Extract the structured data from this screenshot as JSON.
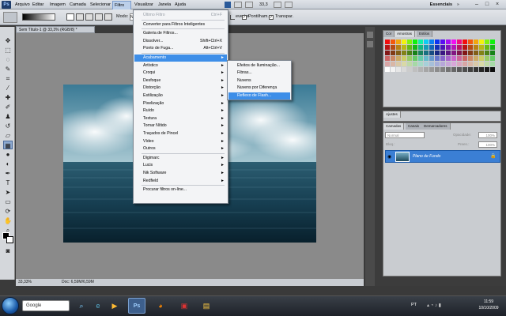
{
  "menubar": {
    "logo": "Ps",
    "items": [
      "Arquivo",
      "Editar",
      "Imagem",
      "Camada",
      "Selecionar",
      "Filtro",
      "Visualizar",
      "Janela",
      "Ajuda"
    ],
    "zoom": "33,3",
    "workspace": "Essenciais"
  },
  "options": {
    "mode_label": "Modo:",
    "mode_value": "N",
    "reverter": "everter",
    "pontilham": "Pontilham.",
    "transpar": "Transpar."
  },
  "document": {
    "tab": "Sem Título-1 @ 33,3% (RGB/8) *",
    "zoom": "33,33%",
    "doc_info": "Doc: 6,59M/6,59M"
  },
  "filter_menu": {
    "items": [
      {
        "label": "Último Filtro",
        "shortcut": "Ctrl+F",
        "disabled": true
      },
      {
        "label": "Converter para Filtros Inteligentes"
      },
      {
        "label": "Galeria de Filtros..."
      },
      {
        "label": "Dissolver...",
        "shortcut": "Shift+Ctrl+X"
      },
      {
        "label": "Ponto de Fuga...",
        "shortcut": "Alt+Ctrl+V"
      },
      {
        "label": "Acabamento",
        "submenu": true
      },
      {
        "label": "Artístico",
        "submenu": true
      },
      {
        "label": "Croqui",
        "submenu": true
      },
      {
        "label": "Desfoque",
        "submenu": true
      },
      {
        "label": "Distorção",
        "submenu": true
      },
      {
        "label": "Estilização",
        "submenu": true
      },
      {
        "label": "Pixelização",
        "submenu": true
      },
      {
        "label": "Ruído",
        "submenu": true
      },
      {
        "label": "Textura",
        "submenu": true
      },
      {
        "label": "Tornar Nítido",
        "submenu": true
      },
      {
        "label": "Traçados de Pincel",
        "submenu": true
      },
      {
        "label": "Vídeo",
        "submenu": true
      },
      {
        "label": "Outros",
        "submenu": true
      },
      {
        "label": "Digimarc",
        "submenu": true
      },
      {
        "label": "Lucis",
        "submenu": true
      },
      {
        "label": "Nik Software",
        "submenu": true
      },
      {
        "label": "Redfield",
        "submenu": true
      },
      {
        "label": "Procurar filtros on-line..."
      }
    ]
  },
  "submenu": {
    "items": [
      "Efeitos de Iluminação...",
      "Fibras...",
      "Nuvens",
      "Nuvens por Diferença",
      "Reflexo de Flash..."
    ]
  },
  "swatches": {
    "tabs": [
      "Cor",
      "Amostras",
      "Estilos"
    ],
    "active": "Amostras"
  },
  "adjustments": {
    "tab": "Ajustes"
  },
  "layers": {
    "tabs": [
      "Camadas",
      "Canais",
      "Demarcadores"
    ],
    "blend": "Normal",
    "opacity_label": "Opacidade:",
    "opacity": "100%",
    "lock_label": "Bloq.:",
    "fill_label": "Preen.:",
    "fill": "100%",
    "layer_name": "Plano de Fundo"
  },
  "taskbar": {
    "search": "Google",
    "lang": "PT",
    "time": "11:59",
    "date": "10/10/2009"
  }
}
